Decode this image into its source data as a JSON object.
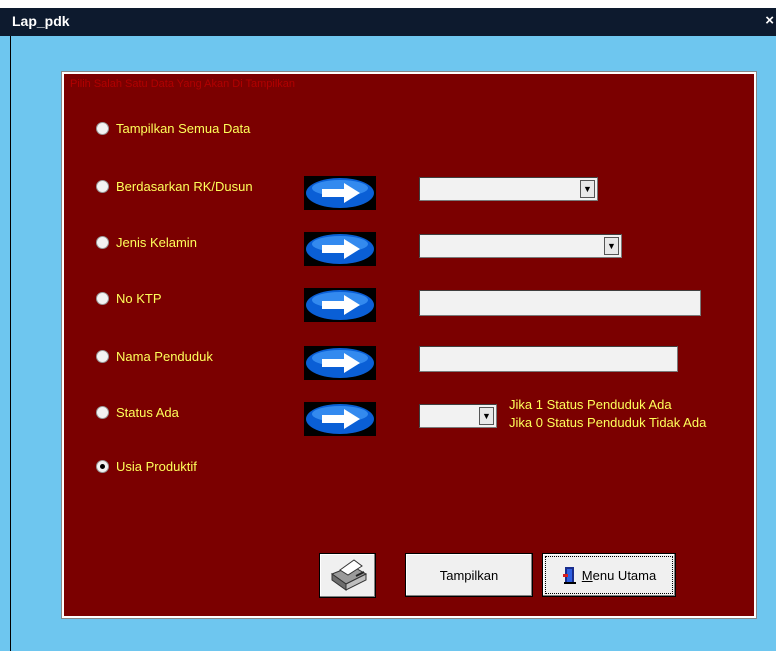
{
  "window": {
    "title": "Lap_pdk",
    "close_label": "×"
  },
  "frame": {
    "caption": "Pilih Salah Satu Data Yang Akan Di Tampilkan"
  },
  "options": [
    {
      "label": "Tampilkan Semua Data",
      "selected": false
    },
    {
      "label": "Berdasarkan RK/Dusun",
      "selected": false
    },
    {
      "label": "Jenis Kelamin",
      "selected": false
    },
    {
      "label": "No KTP",
      "selected": false
    },
    {
      "label": "Nama Penduduk",
      "selected": false
    },
    {
      "label": "Status Ada",
      "selected": false
    },
    {
      "label": "Usia Produktif",
      "selected": true
    }
  ],
  "fields": {
    "rk_dusun": {
      "value": ""
    },
    "jenis_kelamin": {
      "value": ""
    },
    "no_ktp": {
      "value": ""
    },
    "nama_penduduk": {
      "value": ""
    },
    "status_ada": {
      "value": ""
    }
  },
  "status_notes": {
    "line1": "Jika 1 Status Penduduk Ada",
    "line2": "Jika 0 Status Penduduk Tidak Ada"
  },
  "buttons": {
    "print_icon": "printer-icon",
    "tampilkan": "Tampilkan",
    "menu_utama": "Menu Utama"
  },
  "colors": {
    "frame_bg": "#7b0000",
    "label_text": "#ffff5a",
    "window_bg": "#6ec6ef",
    "titlebar": "#0d1a2e"
  }
}
